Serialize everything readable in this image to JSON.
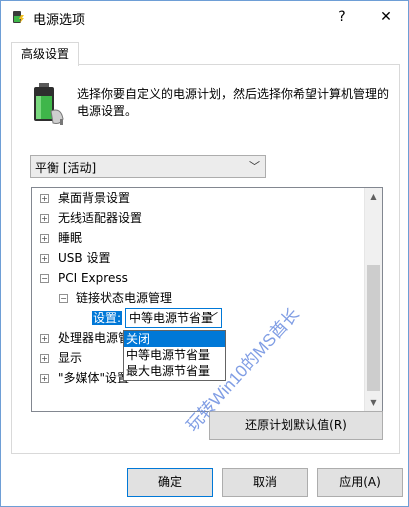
{
  "window": {
    "title": "电源选项",
    "help_label": "?",
    "close_label": "✕"
  },
  "tabs": [
    {
      "label": "高级设置"
    }
  ],
  "intro_text": "选择你要自定义的电源计划，然后选择你希望计算机管理的电源设置。",
  "plan_combo": {
    "value": "平衡 [活动]"
  },
  "tree": {
    "items": [
      {
        "label": "桌面背景设置",
        "expander": "+"
      },
      {
        "label": "无线适配器设置",
        "expander": "+"
      },
      {
        "label": "睡眠",
        "expander": "+"
      },
      {
        "label": "USB 设置",
        "expander": "+"
      },
      {
        "label": "PCI Express",
        "expander": "−"
      },
      {
        "label": "链接状态电源管理",
        "expander": "−"
      },
      {
        "label": "处理器电源管理",
        "expander": "+"
      },
      {
        "label": "显示",
        "expander": "+"
      },
      {
        "label": "\"多媒体\"设置",
        "expander": "+"
      }
    ],
    "setting_label": "设置:",
    "setting_value": "中等电源节省量",
    "dropdown_options": [
      "关闭",
      "中等电源节省量",
      "最大电源节省量"
    ],
    "selected_option_index": 0
  },
  "buttons": {
    "restore_defaults": "还原计划默认值(R)",
    "ok": "确定",
    "cancel": "取消",
    "apply": "应用(A)"
  },
  "watermark": "玩转Win10的MS酋长",
  "colors": {
    "accent": "#0078d7",
    "window_border": "#6e9ed6",
    "watermark": "#6a8de0"
  }
}
